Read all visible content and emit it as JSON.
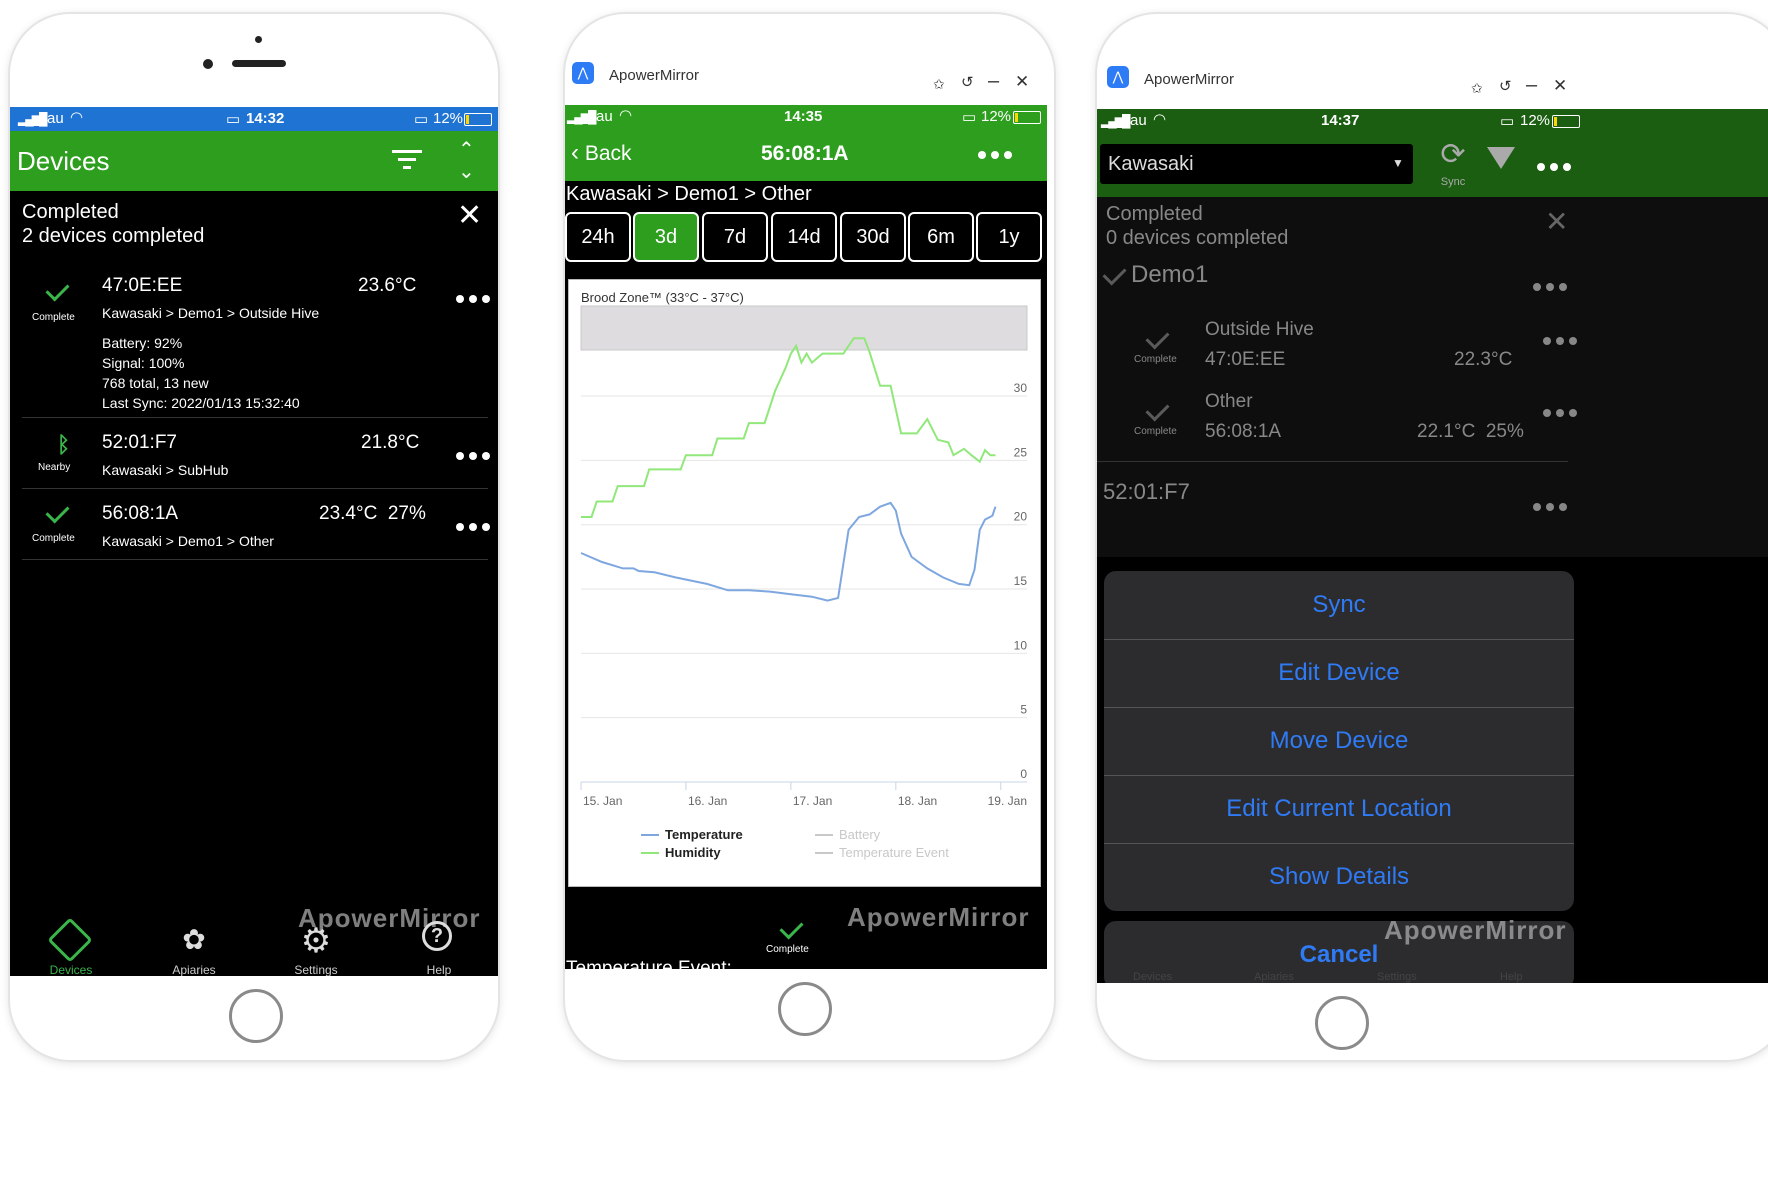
{
  "colors": {
    "green": "#2e9e1f",
    "status_blue": "#1f73d2",
    "link_blue": "#2f7bf6"
  },
  "watermark": "ApowerMirror",
  "phone1": {
    "status": {
      "carrier": "au",
      "time": "14:32",
      "battery": "12%"
    },
    "header": {
      "title": "Devices"
    },
    "banner": {
      "title": "Completed",
      "subtitle": "2 devices completed"
    },
    "devices": [
      {
        "id": "47:0E:EE",
        "status": "Complete",
        "value": "23.6°C",
        "path": "Kawasaki > Demo1 > Outside Hive",
        "battery": "Battery: 92%",
        "signal": "Signal: 100%",
        "records": "768 total, 13 new",
        "last_sync": "Last Sync: 2022/01/13 15:32:40"
      },
      {
        "id": "52:01:F7",
        "status": "Nearby",
        "value": "21.8°C",
        "path": "Kawasaki > SubHub"
      },
      {
        "id": "56:08:1A",
        "status": "Complete",
        "value": "23.4°C  27%",
        "path": "Kawasaki > Demo1 > Other"
      }
    ],
    "nav": [
      {
        "label": "Devices",
        "icon": "devices-icon"
      },
      {
        "label": "Apiaries",
        "icon": "apiaries-icon"
      },
      {
        "label": "Settings",
        "icon": "gear-icon"
      },
      {
        "label": "Help",
        "icon": "help-icon"
      }
    ]
  },
  "phone2": {
    "window_title": "ApowerMirror",
    "status": {
      "carrier": "au",
      "time": "14:35",
      "battery": "12%"
    },
    "nav": {
      "back": "Back",
      "title": "56:08:1A"
    },
    "breadcrumb": "Kawasaki > Demo1 > Other",
    "ranges": [
      "24h",
      "3d",
      "7d",
      "14d",
      "30d",
      "6m",
      "1y"
    ],
    "active_range": "3d",
    "chart_header": "Brood Zone™ (33°C - 37°C)",
    "bottom_status": "Complete",
    "bottom_text": "Temperature Event:"
  },
  "chart_data": {
    "type": "line",
    "band": {
      "label": "Brood Zone™ (33°C - 37°C)",
      "range": [
        33,
        37
      ]
    },
    "x_ticks": [
      "15. Jan",
      "16. Jan",
      "17. Jan",
      "18. Jan",
      "19. Jan"
    ],
    "x_range": [
      0,
      4.25
    ],
    "y_ticks": [
      0,
      5,
      10,
      15,
      20,
      25,
      30
    ],
    "ylim": [
      0,
      37
    ],
    "legend": [
      {
        "name": "Temperature",
        "color": "#7ea7e0",
        "enabled": true
      },
      {
        "name": "Humidity",
        "color": "#90e87a",
        "enabled": true
      },
      {
        "name": "Battery",
        "color": "#c8c8c8",
        "enabled": false
      },
      {
        "name": "Temperature Event",
        "color": "#c8c8c8",
        "enabled": false
      }
    ],
    "series": [
      {
        "name": "Temperature",
        "color": "#7ea7e0",
        "points": [
          [
            0,
            17.8
          ],
          [
            0.2,
            17.1
          ],
          [
            0.4,
            16.6
          ],
          [
            0.5,
            16.6
          ],
          [
            0.55,
            16.4
          ],
          [
            0.7,
            16.3
          ],
          [
            0.9,
            15.9
          ],
          [
            1.2,
            15.4
          ],
          [
            1.4,
            14.9
          ],
          [
            1.6,
            14.9
          ],
          [
            1.8,
            14.8
          ],
          [
            2,
            14.6
          ],
          [
            2.2,
            14.4
          ],
          [
            2.35,
            14.1
          ],
          [
            2.45,
            14.3
          ],
          [
            2.55,
            19.6
          ],
          [
            2.65,
            20.6
          ],
          [
            2.75,
            20.8
          ],
          [
            2.85,
            21.4
          ],
          [
            2.95,
            21.7
          ],
          [
            3,
            21.1
          ],
          [
            3.05,
            19.3
          ],
          [
            3.15,
            17.5
          ],
          [
            3.3,
            16.6
          ],
          [
            3.45,
            15.9
          ],
          [
            3.6,
            15.4
          ],
          [
            3.7,
            15.3
          ],
          [
            3.75,
            16.5
          ],
          [
            3.8,
            19.6
          ],
          [
            3.85,
            20.4
          ],
          [
            3.92,
            20.7
          ],
          [
            3.95,
            21.4
          ]
        ]
      },
      {
        "name": "Humidity",
        "color": "#90e87a",
        "points": [
          [
            0,
            20.6
          ],
          [
            0.1,
            20.6
          ],
          [
            0.15,
            21.8
          ],
          [
            0.3,
            21.8
          ],
          [
            0.35,
            23.0
          ],
          [
            0.6,
            23.0
          ],
          [
            0.65,
            24.3
          ],
          [
            0.95,
            24.3
          ],
          [
            1.0,
            25.4
          ],
          [
            1.25,
            25.4
          ],
          [
            1.3,
            26.7
          ],
          [
            1.55,
            26.7
          ],
          [
            1.6,
            27.9
          ],
          [
            1.75,
            27.9
          ],
          [
            1.85,
            30.4
          ],
          [
            1.95,
            32.2
          ],
          [
            2.0,
            33.3
          ],
          [
            2.05,
            33.9
          ],
          [
            2.1,
            32.6
          ],
          [
            2.15,
            33.3
          ],
          [
            2.2,
            32.6
          ],
          [
            2.3,
            33.3
          ],
          [
            2.5,
            33.3
          ],
          [
            2.6,
            34.5
          ],
          [
            2.7,
            34.5
          ],
          [
            2.75,
            33.4
          ],
          [
            2.85,
            30.8
          ],
          [
            2.95,
            30.8
          ],
          [
            3.05,
            27.1
          ],
          [
            3.2,
            27.1
          ],
          [
            3.3,
            28.2
          ],
          [
            3.4,
            26.6
          ],
          [
            3.5,
            26.4
          ],
          [
            3.55,
            25.4
          ],
          [
            3.65,
            25.9
          ],
          [
            3.72,
            25.4
          ],
          [
            3.8,
            24.9
          ],
          [
            3.85,
            25.8
          ],
          [
            3.9,
            25.4
          ],
          [
            3.95,
            25.4
          ]
        ]
      }
    ]
  },
  "phone3": {
    "window_title": "ApowerMirror",
    "status": {
      "carrier": "au",
      "time": "14:37",
      "battery": "12%"
    },
    "location_select": "Kawasaki",
    "sync_label": "Sync",
    "banner": {
      "title": "Completed",
      "subtitle": "0 devices completed"
    },
    "group": "Demo1",
    "devices": [
      {
        "name": "Outside Hive",
        "id": "47:0E:EE",
        "status": "Complete",
        "value": "22.3°C"
      },
      {
        "name": "Other",
        "id": "56:08:1A",
        "status": "Complete",
        "value": "22.1°C  25%"
      }
    ],
    "ungrouped": "52:01:F7",
    "actions": [
      "Sync",
      "Edit Device",
      "Move Device",
      "Edit Current Location",
      "Show Details"
    ],
    "cancel": "Cancel",
    "nav": [
      "Devices",
      "Apiaries",
      "Settings",
      "Help"
    ]
  }
}
